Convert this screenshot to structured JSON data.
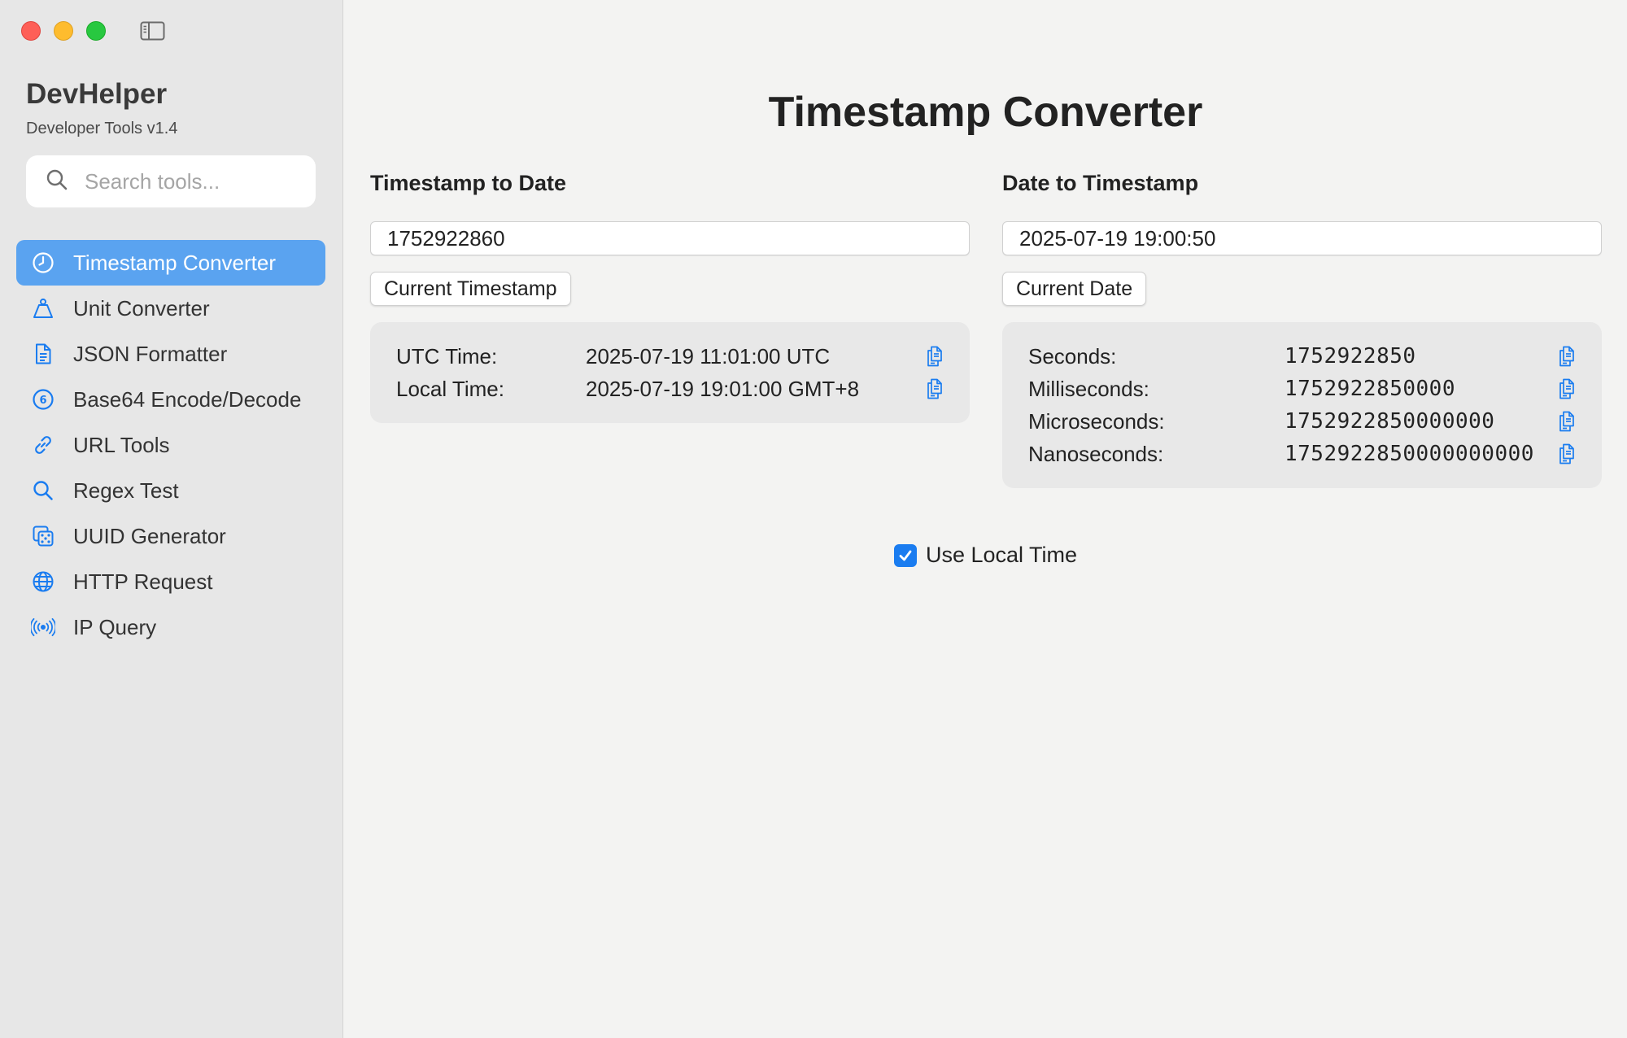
{
  "sidebar": {
    "app_title": "DevHelper",
    "app_subtitle": "Developer Tools v1.4",
    "search_placeholder": "Search tools...",
    "items": [
      {
        "label": "Timestamp Converter",
        "icon": "clock-icon",
        "active": true
      },
      {
        "label": "Unit Converter",
        "icon": "scale-icon"
      },
      {
        "label": "JSON Formatter",
        "icon": "document-icon"
      },
      {
        "label": "Base64 Encode/Decode",
        "icon": "number-six-circle-icon"
      },
      {
        "label": "URL Tools",
        "icon": "link-icon"
      },
      {
        "label": "Regex Test",
        "icon": "magnifier-icon"
      },
      {
        "label": "UUID Generator",
        "icon": "dice-icon"
      },
      {
        "label": "HTTP Request",
        "icon": "globe-icon"
      },
      {
        "label": "IP Query",
        "icon": "broadcast-icon"
      }
    ]
  },
  "main": {
    "title": "Timestamp Converter",
    "ts_to_date": {
      "title": "Timestamp to Date",
      "input_value": "1752922860",
      "button": "Current Timestamp",
      "rows": [
        {
          "label": "UTC Time:",
          "value": "2025-07-19 11:01:00 UTC"
        },
        {
          "label": "Local Time:",
          "value": "2025-07-19 19:01:00 GMT+8"
        }
      ]
    },
    "date_to_ts": {
      "title": "Date to Timestamp",
      "input_value": "2025-07-19 19:00:50",
      "button": "Current Date",
      "rows": [
        {
          "label": "Seconds:",
          "value": "1752922850"
        },
        {
          "label": "Milliseconds:",
          "value": "1752922850000"
        },
        {
          "label": "Microseconds:",
          "value": "1752922850000000"
        },
        {
          "label": "Nanoseconds:",
          "value": "1752922850000000000"
        }
      ]
    },
    "use_local_time": {
      "label": "Use Local Time",
      "checked": true
    }
  },
  "colors": {
    "accent": "#1a7cf0",
    "active_nav": "#5aa3f0",
    "sidebar_bg": "#e7e7e7",
    "main_bg": "#f3f3f2"
  }
}
